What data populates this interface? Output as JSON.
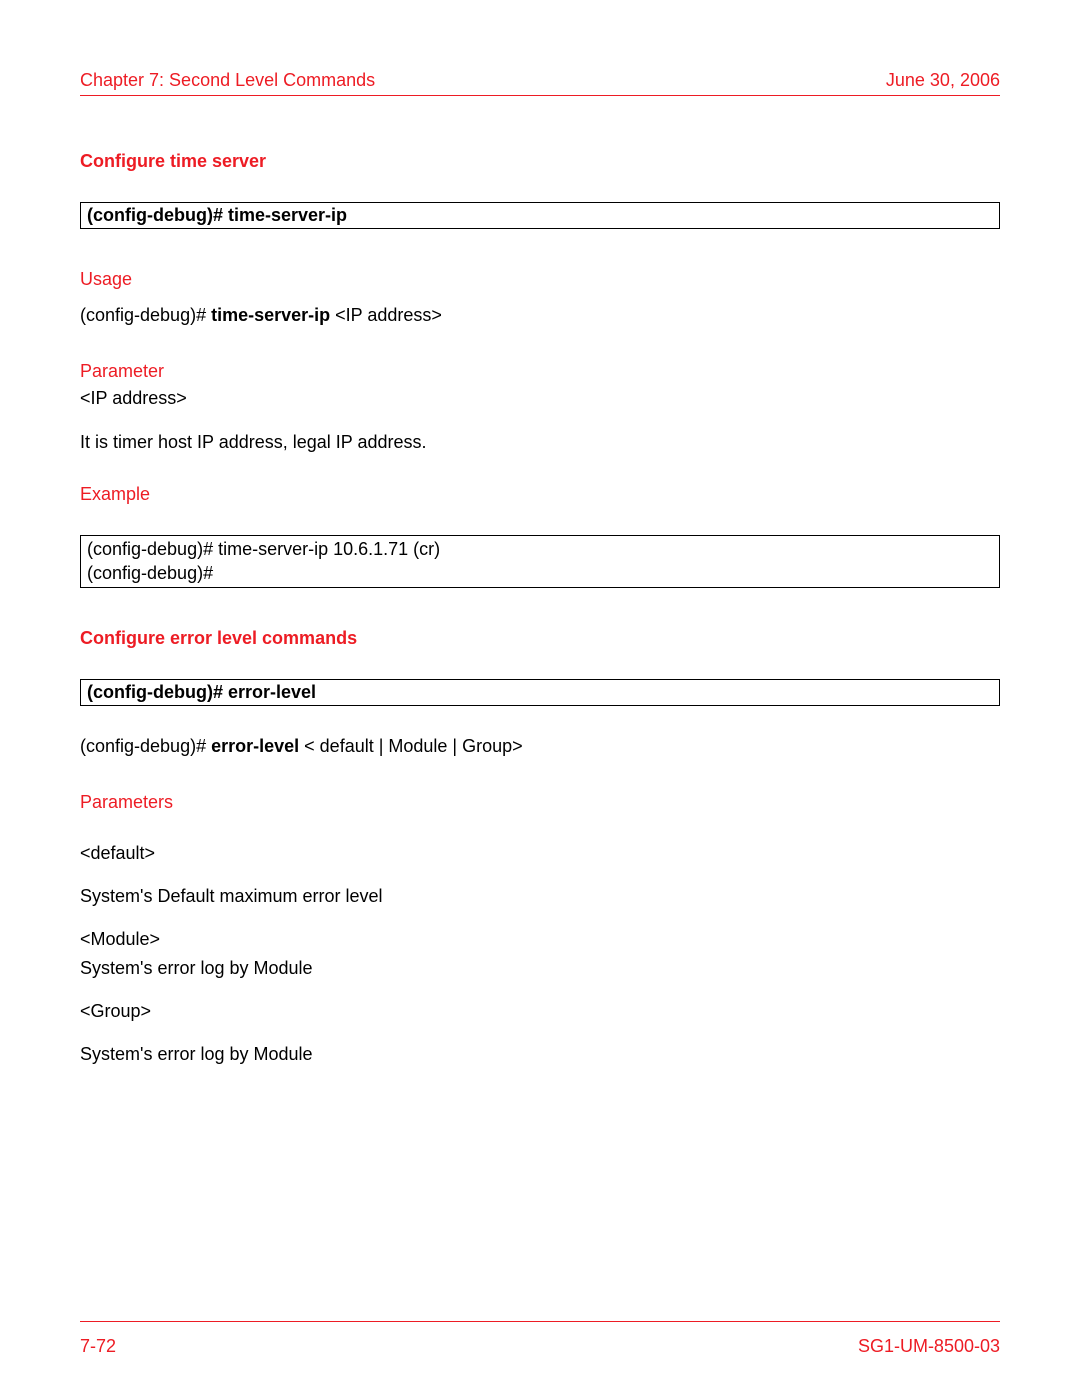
{
  "header": {
    "left": "Chapter 7: Second Level Commands",
    "right": "June 30, 2006"
  },
  "section1": {
    "title": "Configure time server",
    "command_box": "(config-debug)# time-server-ip",
    "usage": {
      "heading": "Usage",
      "prefix": "(config-debug)# ",
      "cmd": "time-server-ip",
      "suffix": " <IP address>"
    },
    "parameter": {
      "heading": "Parameter",
      "line1": "<IP address>",
      "line2": "It is timer host IP address, legal IP address."
    },
    "example": {
      "heading": "Example",
      "line1": "(config-debug)# time-server-ip 10.6.1.71 (cr)",
      "line2": "(config-debug)#"
    }
  },
  "section2": {
    "title": "Configure error level commands",
    "command_box": "(config-debug)# error-level",
    "usage": {
      "prefix": "(config-debug)# ",
      "cmd": "error-level",
      "suffix": " < default | Module | Group>"
    },
    "parameters": {
      "heading": "Parameters",
      "p1_name": "<default>",
      "p1_desc": "System's Default maximum error level",
      "p2_name": "<Module>",
      "p2_desc": "System's error log by Module",
      "p3_name": "<Group>",
      "p3_desc": "System's error log by Module"
    }
  },
  "footer": {
    "left": "7-72",
    "right": "SG1-UM-8500-03"
  }
}
